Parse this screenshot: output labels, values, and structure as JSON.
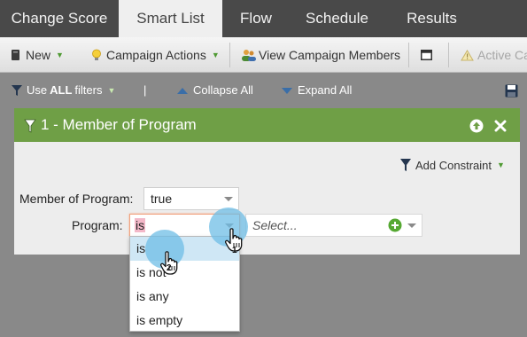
{
  "tabs": [
    {
      "label": "Change Score"
    },
    {
      "label": "Smart List"
    },
    {
      "label": "Flow"
    },
    {
      "label": "Schedule"
    },
    {
      "label": "Results"
    }
  ],
  "toolbar": {
    "new_label": "New",
    "campaign_actions_label": "Campaign Actions",
    "view_members_label": "View Campaign Members",
    "active_label": "Active Ca"
  },
  "filterbar": {
    "use_prefix": "Use",
    "use_all": "ALL",
    "use_suffix": "filters",
    "separator": "|",
    "collapse_label": "Collapse All",
    "expand_label": "Expand All"
  },
  "filter": {
    "title": "1 - Member of Program",
    "add_constraint_label": "Add Constraint",
    "member_label": "Member of Program:",
    "member_value": "true",
    "program_label": "Program:",
    "operator_value": "is",
    "program_placeholder": "Select..."
  },
  "operator_options": [
    {
      "label": "is"
    },
    {
      "label": "is not"
    },
    {
      "label": "is any"
    },
    {
      "label": "is empty"
    }
  ],
  "markers": {
    "first": "1",
    "second": "2"
  },
  "colors": {
    "tab_bar": "#494949",
    "active_tab": "#efefef",
    "panel_header": "#6f9f46",
    "selected_option": "#cfe7f5",
    "marker": "#6fbee6"
  }
}
